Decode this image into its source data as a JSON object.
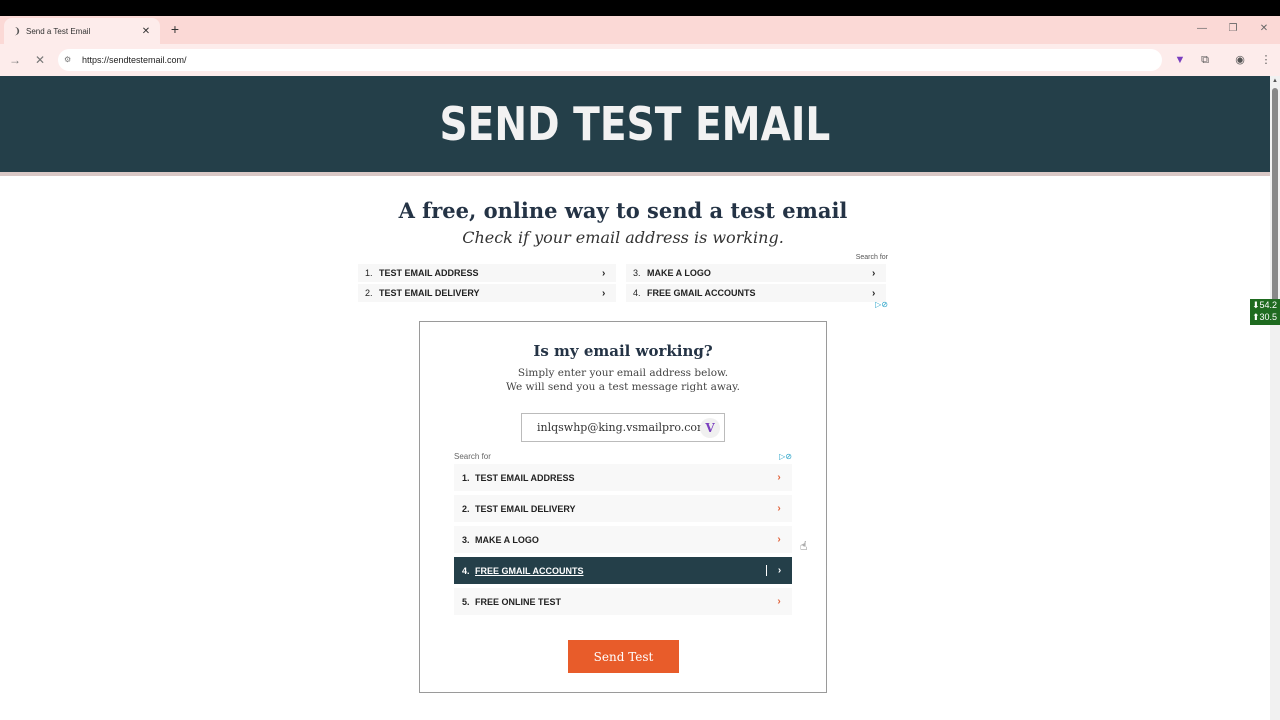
{
  "browser": {
    "tab_title": "Send a Test Email",
    "tab_close": "✕",
    "new_tab": "+",
    "url": "https://sendtestemail.com/",
    "window_controls": [
      "—",
      "❐",
      "✕"
    ]
  },
  "netspeed": {
    "down": "⬇54.2",
    "up": "⬆30.5"
  },
  "hero": {
    "title": "SEND TEST EMAIL"
  },
  "intro": {
    "headline": "A free, online way to send a test email",
    "subhead": "Check if your email address is working."
  },
  "ad_top": {
    "search_for": "Search for",
    "items": [
      {
        "num": "1.",
        "label": "TEST EMAIL ADDRESS"
      },
      {
        "num": "2.",
        "label": "TEST EMAIL DELIVERY"
      },
      {
        "num": "3.",
        "label": "MAKE A LOGO"
      },
      {
        "num": "4.",
        "label": "FREE GMAIL ACCOUNTS"
      }
    ],
    "chevron": "›"
  },
  "card": {
    "title": "Is my email working?",
    "desc_line1": "Simply enter your email address below.",
    "desc_line2": "We will send you a test message right away.",
    "email_value": "inlqswhp@king.vsmailpro.com",
    "extension_badge": "V",
    "send_label": "Send Test"
  },
  "ad_inner": {
    "search_for": "Search for",
    "items": [
      {
        "num": "1.",
        "label": "TEST EMAIL ADDRESS"
      },
      {
        "num": "2.",
        "label": "TEST EMAIL DELIVERY"
      },
      {
        "num": "3.",
        "label": "MAKE A LOGO"
      },
      {
        "num": "4.",
        "label": "FREE GMAIL ACCOUNTS"
      },
      {
        "num": "5.",
        "label": "FREE ONLINE TEST"
      }
    ],
    "active_index": 3,
    "chevron": "›"
  },
  "colors": {
    "hero_bg": "#243f49",
    "accent": "#e85c2a",
    "tabstrip_bg": "#fbd9d6"
  }
}
